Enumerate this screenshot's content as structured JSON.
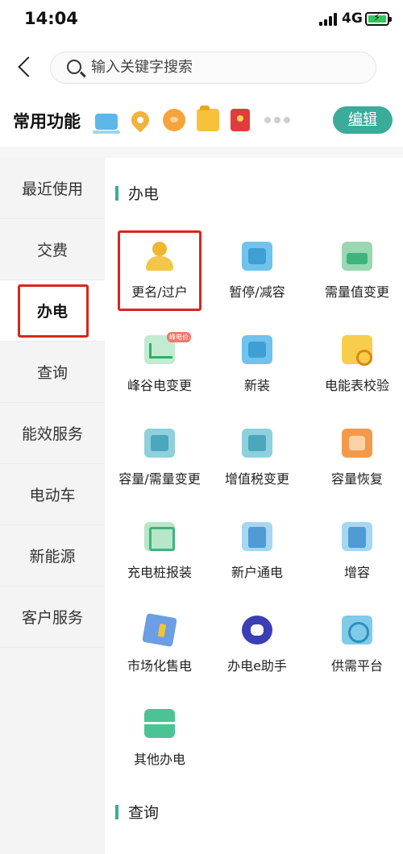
{
  "status_bar": {
    "time": "14:04",
    "network": "4G"
  },
  "search": {
    "placeholder": "输入关键字搜索"
  },
  "common": {
    "title": "常用功能",
    "edit_label": "编辑",
    "quick_icons": [
      "screen-icon",
      "map-pin-icon",
      "piggy-bank-icon",
      "folder-icon",
      "red-envelope-icon"
    ]
  },
  "sidebar": {
    "items": [
      {
        "label": "最近使用"
      },
      {
        "label": "交费"
      },
      {
        "label": "办电"
      },
      {
        "label": "查询"
      },
      {
        "label": "能效服务"
      },
      {
        "label": "电动车"
      },
      {
        "label": "新能源"
      },
      {
        "label": "客户服务"
      }
    ],
    "active": "办电"
  },
  "main": {
    "section1_title": "办电",
    "section2_title": "查询",
    "items": [
      {
        "label": "更名/过户",
        "icon": "person-icon"
      },
      {
        "label": "暂停/减容",
        "icon": "pause-device-icon"
      },
      {
        "label": "需量值变更",
        "icon": "demand-meter-icon"
      },
      {
        "label": "峰谷电变更",
        "icon": "peak-valley-icon",
        "badge": "峰电价"
      },
      {
        "label": "新装",
        "icon": "new-install-icon"
      },
      {
        "label": "电能表校验",
        "icon": "meter-check-icon"
      },
      {
        "label": "容量/需量变更",
        "icon": "capacity-change-icon"
      },
      {
        "label": "增值税变更",
        "icon": "vat-change-icon"
      },
      {
        "label": "容量恢复",
        "icon": "capacity-restore-icon"
      },
      {
        "label": "充电桩报装",
        "icon": "charging-pile-icon"
      },
      {
        "label": "新户通电",
        "icon": "new-household-power-icon"
      },
      {
        "label": "增容",
        "icon": "capacity-increase-icon"
      },
      {
        "label": "市场化售电",
        "icon": "market-sale-icon"
      },
      {
        "label": "办电e助手",
        "icon": "robot-assistant-icon"
      },
      {
        "label": "供需平台",
        "icon": "supply-demand-icon"
      },
      {
        "label": "其他办电",
        "icon": "briefcase-icon"
      }
    ]
  }
}
